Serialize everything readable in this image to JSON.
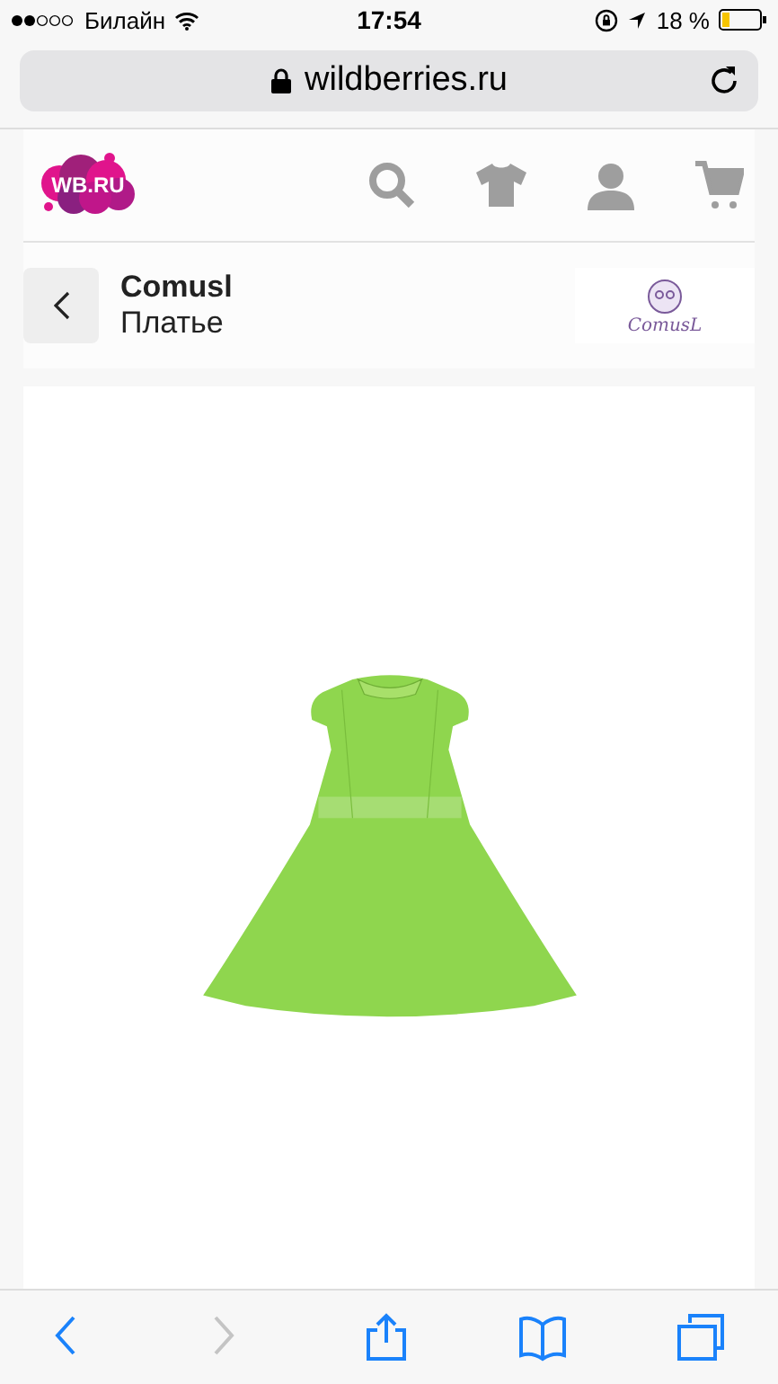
{
  "status_bar": {
    "carrier": "Билайн",
    "time": "17:54",
    "battery": "18 %"
  },
  "address_bar": {
    "url": "wildberries.ru"
  },
  "site_header": {
    "logo": "WB.RU"
  },
  "product": {
    "brand": "Comusl",
    "name": "Платье",
    "brand_logo": "ComusL"
  },
  "toolbar": [
    {
      "kind": "back",
      "disabled": false
    },
    {
      "kind": "forward",
      "disabled": true
    },
    {
      "kind": "share",
      "disabled": false
    },
    {
      "kind": "bookmarks",
      "disabled": false
    },
    {
      "kind": "tabs",
      "disabled": false
    }
  ]
}
